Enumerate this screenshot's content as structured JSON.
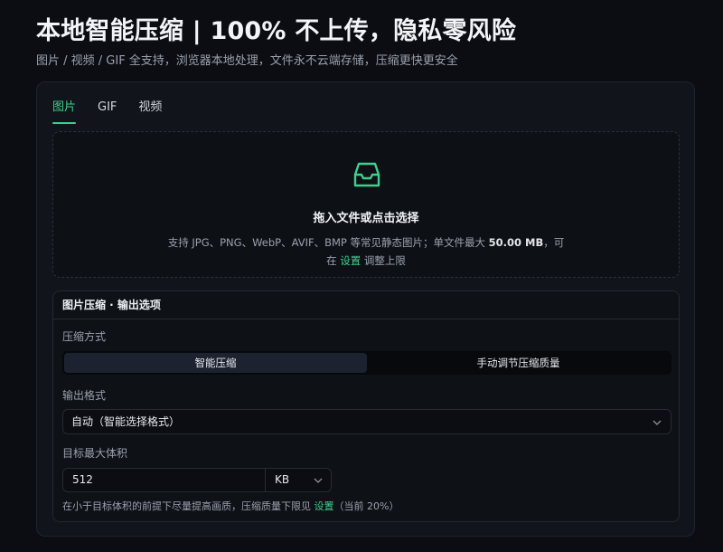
{
  "header": {
    "title": "本地智能压缩 | 100% 不上传，隐私零风险",
    "subtitle": "图片 / 视频 / GIF 全支持，浏览器本地处理，文件永不云端存储，压缩更快更安全"
  },
  "tabs": [
    {
      "label": "图片",
      "active": true
    },
    {
      "label": "GIF",
      "active": false
    },
    {
      "label": "视频",
      "active": false
    }
  ],
  "dropzone": {
    "icon": "inbox-icon",
    "title": "拖入文件或点击选择",
    "desc_prefix": "支持 JPG、PNG、WebP、AVIF、BMP 等常见静态图片；单文件最大",
    "max_size": "50.00 MB",
    "desc_suffix": "，可",
    "line2_prefix": "在",
    "settings_link": "设置",
    "line2_suffix": "调整上限"
  },
  "options": {
    "header": "图片压缩 · 输出选项",
    "mode_label": "压缩方式",
    "modes": [
      {
        "label": "智能压缩",
        "active": true
      },
      {
        "label": "手动调节压缩质量",
        "active": false
      }
    ],
    "format_label": "输出格式",
    "format_value": "自动（智能选择格式）",
    "target_label": "目标最大体积",
    "target_value": "512",
    "target_unit": "KB",
    "note_prefix": "在小于目标体积的前提下尽量提高画质，压缩质量下限见",
    "note_link": "设置",
    "note_suffix": "（当前 20%）"
  },
  "colors": {
    "accent": "#3ecf8e",
    "background": "#0b0d12",
    "card": "#11141a"
  }
}
